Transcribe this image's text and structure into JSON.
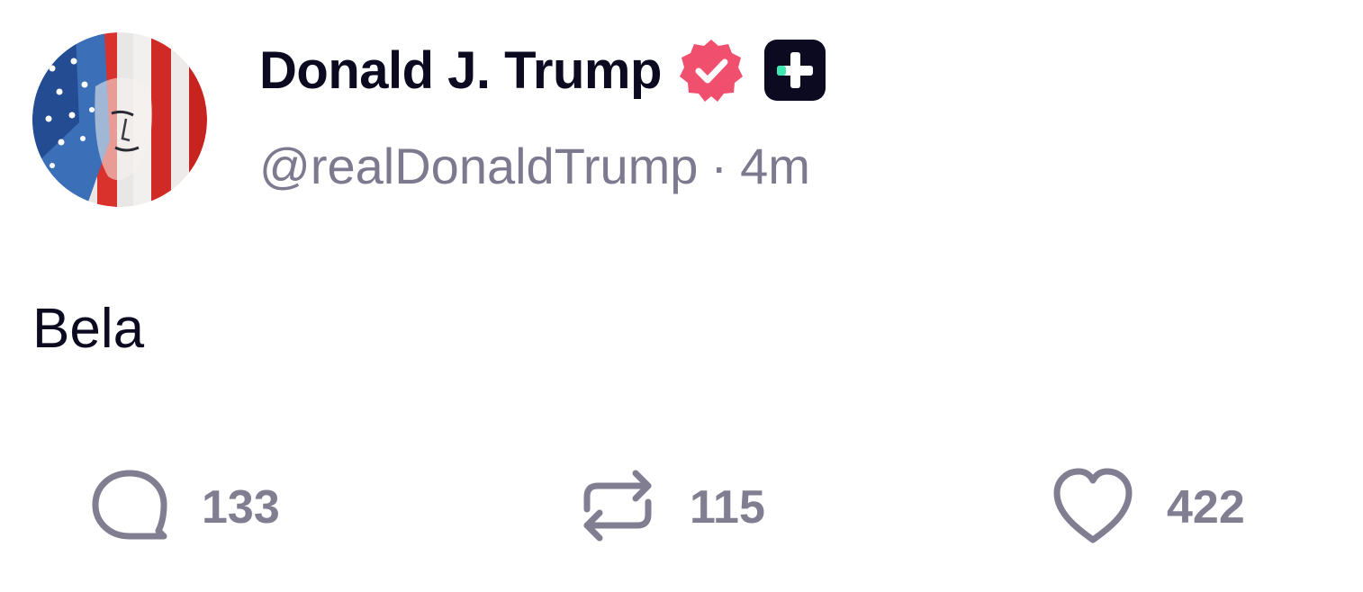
{
  "post": {
    "author": {
      "display_name": "Donald J. Trump",
      "handle": "@realDonaldTrump",
      "verified": true,
      "verified_badge_icon": "verified-badge-icon",
      "verified_badge_color": "#f0506e",
      "plus_badge_icon": "plus-badge-icon",
      "plus_badge_color": "#0b0a21",
      "plus_badge_accent": "#3ee6b2"
    },
    "separator": "·",
    "timestamp": "4m",
    "body": "Bela",
    "actions": {
      "reply": {
        "icon": "reply-icon",
        "count": "133"
      },
      "repost": {
        "icon": "repost-icon",
        "count": "115"
      },
      "like": {
        "icon": "heart-icon",
        "count": "422"
      }
    },
    "colors": {
      "text_primary": "#0b0a21",
      "text_secondary": "#7d7a90",
      "icon_gray": "#817e91"
    }
  }
}
